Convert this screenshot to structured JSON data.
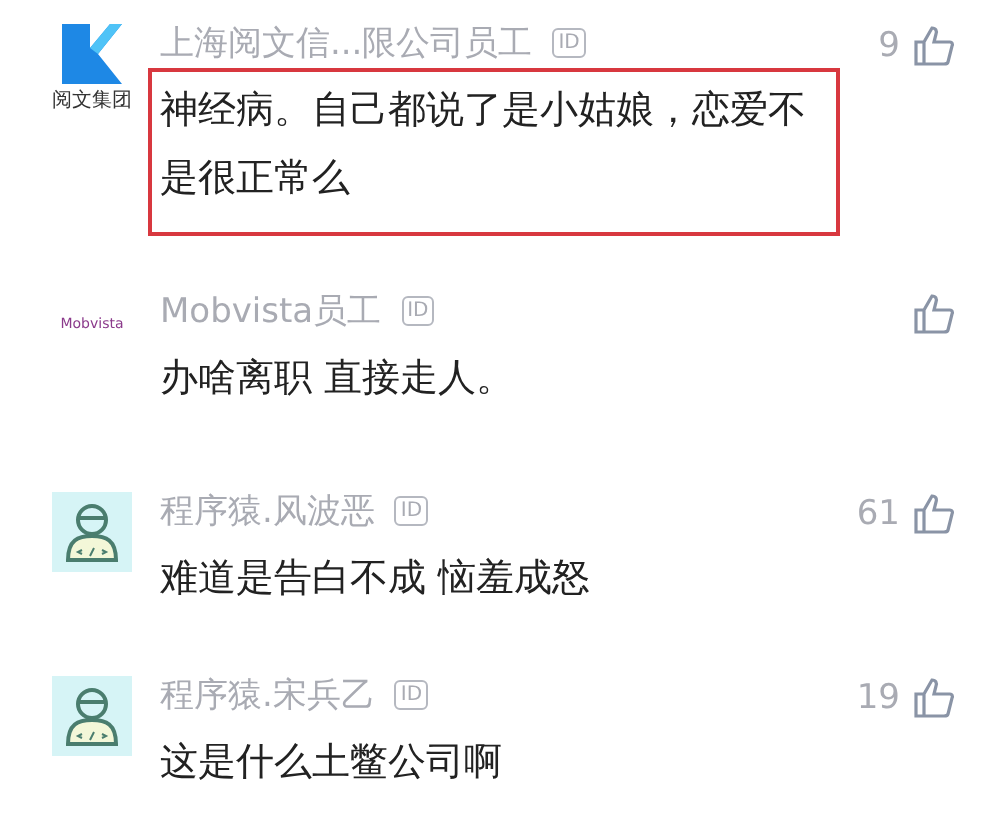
{
  "comments": [
    {
      "avatar": {
        "kind": "k-logo",
        "caption": "阅文集团"
      },
      "name": "上海阅文信...限公司员工",
      "badge": "ID",
      "likes": "9",
      "text": "神经病。自己都说了是小姑娘，恋爱不是很正常么",
      "highlighted": true
    },
    {
      "avatar": {
        "kind": "wordmark",
        "caption": "Mobvista"
      },
      "name": "Mobvista员工",
      "badge": "ID",
      "text": "办啥离职 直接走人。",
      "highlighted": false
    },
    {
      "avatar": {
        "kind": "coder"
      },
      "name": "程序猿.风波恶",
      "badge": "ID",
      "likes": "61",
      "text": "难道是告白不成 恼羞成怒",
      "highlighted": false
    },
    {
      "avatar": {
        "kind": "coder"
      },
      "name": "程序猿.宋兵乙",
      "badge": "ID",
      "likes": "19",
      "text": "这是什么土鳖公司啊",
      "highlighted": false
    }
  ]
}
